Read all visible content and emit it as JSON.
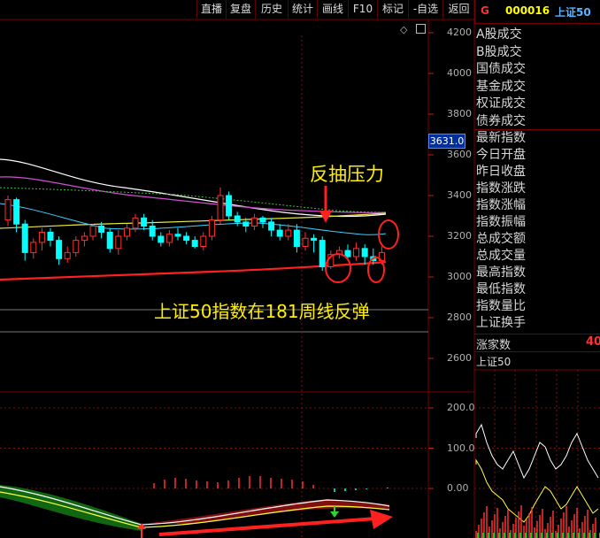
{
  "toolbar": {
    "buttons": [
      "直播",
      "复盘",
      "历史",
      "统计",
      "画线",
      "F10",
      "标记",
      "-自选",
      "返回"
    ]
  },
  "quote": {
    "market_flag": "G",
    "code": "000016",
    "name": "上证50"
  },
  "right_panel": {
    "volume_items": [
      "A股成交",
      "B股成交",
      "国债成交",
      "基金成交",
      "权证成交",
      "债券成交"
    ],
    "index_items": [
      "最新指数",
      "今日开盘",
      "昨日收盘",
      "指数涨跌",
      "指数涨幅",
      "指数振幅",
      "总成交额",
      "总成交量",
      "最高指数",
      "最低指数",
      "指数量比",
      "上证换手"
    ],
    "advancers_label": "涨家数",
    "advancers_value": "40",
    "mini_chart_title": "上证50"
  },
  "main_chart": {
    "y_ticks": [
      "4200",
      "4000",
      "3800",
      "3600",
      "3400",
      "3200",
      "3000",
      "2800",
      "2600"
    ],
    "current_price_tag": "3631.0",
    "annotation_resistance": "反抽压力",
    "annotation_support": "上证50指数在181周线反弹"
  },
  "indicator_chart": {
    "y_ticks": [
      "200.0",
      "100.0",
      "0.00"
    ]
  },
  "mini_chart": {
    "y_ticks": [
      "200.0",
      "100.0",
      "0.00"
    ]
  },
  "colors": {
    "up": "#ff3030",
    "down": "#00ffff",
    "border": "#7a0000",
    "annotation": "#ffee00",
    "circle": "#ff2020"
  },
  "chart_data": {
    "type": "candlestick",
    "ylim": [
      2500,
      4250
    ],
    "candles": [
      [
        3280,
        3380,
        3400,
        3250
      ],
      [
        3380,
        3260,
        3390,
        3220
      ],
      [
        3260,
        3120,
        3280,
        3080
      ],
      [
        3120,
        3170,
        3190,
        3090
      ],
      [
        3170,
        3220,
        3240,
        3130
      ],
      [
        3220,
        3180,
        3240,
        3150
      ],
      [
        3180,
        3090,
        3200,
        3060
      ],
      [
        3090,
        3120,
        3150,
        3070
      ],
      [
        3120,
        3180,
        3200,
        3100
      ],
      [
        3180,
        3200,
        3220,
        3150
      ],
      [
        3200,
        3250,
        3260,
        3180
      ],
      [
        3250,
        3220,
        3270,
        3190
      ],
      [
        3220,
        3140,
        3240,
        3120
      ],
      [
        3140,
        3200,
        3230,
        3110
      ],
      [
        3200,
        3240,
        3260,
        3180
      ],
      [
        3240,
        3290,
        3310,
        3220
      ],
      [
        3290,
        3250,
        3310,
        3230
      ],
      [
        3250,
        3200,
        3280,
        3180
      ],
      [
        3200,
        3170,
        3220,
        3150
      ],
      [
        3170,
        3210,
        3230,
        3150
      ],
      [
        3210,
        3200,
        3240,
        3180
      ],
      [
        3200,
        3180,
        3220,
        3160
      ],
      [
        3180,
        3150,
        3200,
        3140
      ],
      [
        3150,
        3200,
        3220,
        3130
      ],
      [
        3200,
        3280,
        3300,
        3180
      ],
      [
        3280,
        3400,
        3440,
        3260
      ],
      [
        3400,
        3300,
        3420,
        3280
      ],
      [
        3300,
        3270,
        3320,
        3250
      ],
      [
        3270,
        3250,
        3290,
        3220
      ],
      [
        3250,
        3290,
        3310,
        3230
      ],
      [
        3290,
        3270,
        3300,
        3240
      ],
      [
        3270,
        3230,
        3290,
        3200
      ],
      [
        3230,
        3200,
        3260,
        3180
      ],
      [
        3200,
        3230,
        3260,
        3180
      ],
      [
        3230,
        3150,
        3260,
        3120
      ],
      [
        3150,
        3190,
        3220,
        3130
      ],
      [
        3190,
        3180,
        3210,
        3120
      ],
      [
        3180,
        3050,
        3200,
        3030
      ],
      [
        3050,
        3110,
        3130,
        3040
      ],
      [
        3110,
        3130,
        3150,
        3090
      ],
      [
        3130,
        3100,
        3160,
        3080
      ],
      [
        3100,
        3140,
        3170,
        3080
      ],
      [
        3140,
        3100,
        3160,
        3060
      ],
      [
        3100,
        3080,
        3140,
        3060
      ],
      [
        3080,
        3120,
        3150,
        3060
      ]
    ]
  }
}
